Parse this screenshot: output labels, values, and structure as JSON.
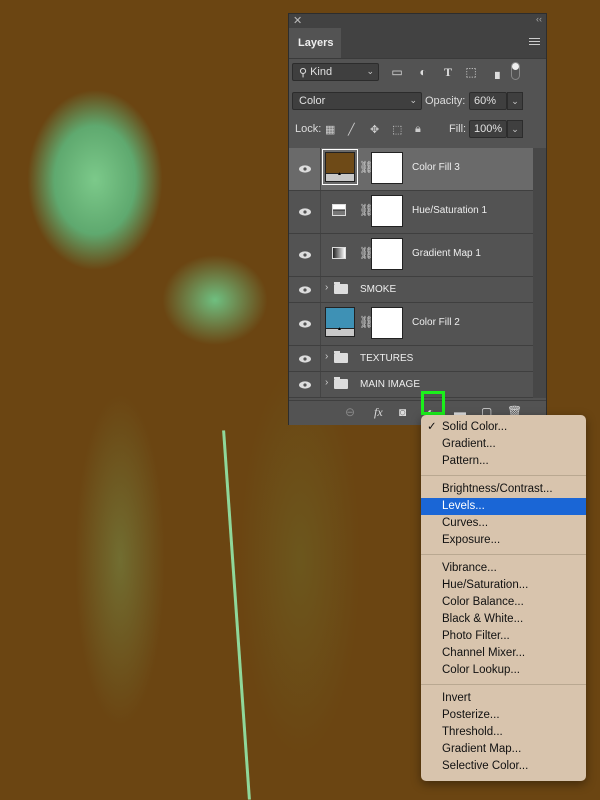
{
  "panel": {
    "title": "Layers",
    "filter": {
      "kind_label": "Kind",
      "icons": [
        "image-filter-icon",
        "adjustment-filter-icon",
        "type-filter-icon",
        "shape-filter-icon",
        "smart-object-filter-icon"
      ]
    },
    "blend_mode": "Color",
    "opacity_label": "Opacity:",
    "opacity_value": "60%",
    "lock_label": "Lock:",
    "fill_label": "Fill:",
    "fill_value": "100%"
  },
  "layers": [
    {
      "name": "Color Fill 3",
      "type": "fill",
      "color": "#6e4a17",
      "selected": true,
      "visible": true
    },
    {
      "name": "Hue/Saturation 1",
      "type": "hue-saturation",
      "visible": true
    },
    {
      "name": "Gradient Map 1",
      "type": "gradient-map",
      "visible": true
    },
    {
      "name": "SMOKE",
      "type": "group",
      "visible": true
    },
    {
      "name": "Color Fill 2",
      "type": "fill",
      "color": "#3e91b5",
      "visible": true
    },
    {
      "name": "TEXTURES",
      "type": "group",
      "visible": true
    },
    {
      "name": "MAIN IMAGE",
      "type": "group",
      "visible": true
    }
  ],
  "menu": {
    "groups": [
      [
        {
          "label": "Solid Color...",
          "checked": true
        },
        {
          "label": "Gradient..."
        },
        {
          "label": "Pattern..."
        }
      ],
      [
        {
          "label": "Brightness/Contrast..."
        },
        {
          "label": "Levels...",
          "highlighted": true
        },
        {
          "label": "Curves..."
        },
        {
          "label": "Exposure..."
        }
      ],
      [
        {
          "label": "Vibrance..."
        },
        {
          "label": "Hue/Saturation..."
        },
        {
          "label": "Color Balance..."
        },
        {
          "label": "Black & White..."
        },
        {
          "label": "Photo Filter..."
        },
        {
          "label": "Channel Mixer..."
        },
        {
          "label": "Color Lookup..."
        }
      ],
      [
        {
          "label": "Invert"
        },
        {
          "label": "Posterize..."
        },
        {
          "label": "Threshold..."
        },
        {
          "label": "Gradient Map..."
        },
        {
          "label": "Selective Color..."
        }
      ]
    ],
    "check_glyph": "✓",
    "highlight_color": "#1a66d6"
  }
}
